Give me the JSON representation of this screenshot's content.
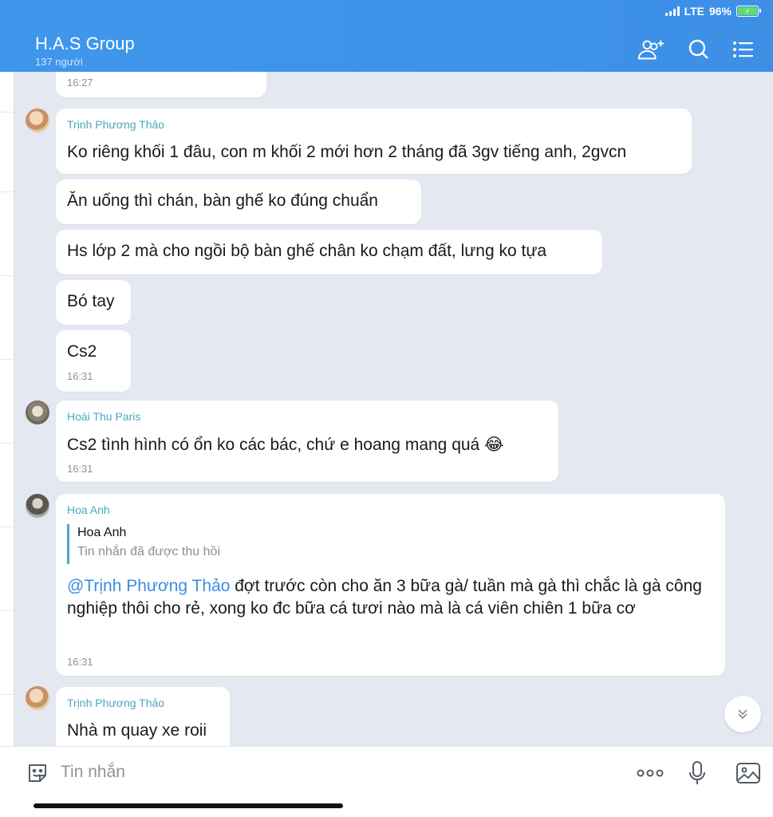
{
  "status_bar": {
    "network": "LTE",
    "battery": "96%"
  },
  "header": {
    "title": "H.A.S Group",
    "subtitle": "137 người",
    "icons": [
      "add-member-icon",
      "search-icon",
      "menu-icon"
    ]
  },
  "messages": [
    {
      "id": "partial",
      "time": "16:27"
    },
    {
      "sender": "Trịnh Phương Thảo",
      "lines": [
        "Ko riêng khối 1 đâu, con m khối 2 mới hơn 2 tháng đã 3gv tiếng anh, 2gvcn",
        "Ăn uống thì chán, bàn ghế ko đúng chuẩn",
        "Hs lớp 2 mà cho ngồi bộ bàn ghế chân ko chạm đất, lưng ko tựa",
        "Bó tay",
        "Cs2"
      ],
      "time": "16:31"
    },
    {
      "sender": "Hoài Thu Paris",
      "text": "Cs2 tình hình có ổn ko các bác, chứ e hoang mang quá 😂",
      "time": "16:31"
    },
    {
      "sender": "Hoa Anh",
      "quote_name": "Hoa Anh",
      "quote_text": "Tin nhắn đã được thu hồi",
      "mention": "@Trịnh Phương Thảo",
      "text": " đợt trước còn cho ăn 3 bữa gà/ tuần mà gà thì chắc là gà công nghiệp thôi cho rẻ, xong ko đc bữa cá tươi nào mà là cá viên chiên 1 bữa cơ",
      "time": "16:31"
    },
    {
      "sender": "Trịnh Phương Thảo",
      "text": "Nhà m quay xe roii"
    }
  ],
  "input": {
    "placeholder": "Tin nhắn"
  },
  "colors": {
    "header": "#3f97ec",
    "chat_bg": "#e3e8f1",
    "sender": "#4aa8c0",
    "mention": "#3a8de0"
  }
}
